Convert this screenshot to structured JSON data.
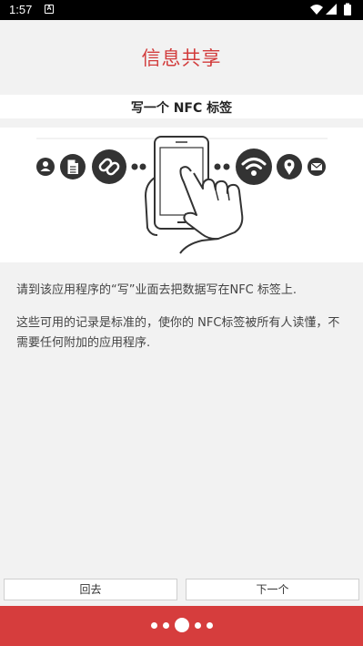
{
  "status_bar": {
    "time": "1:57",
    "notification_icon_letter": "A",
    "icons": [
      "wifi-icon",
      "signal-icon",
      "battery-icon"
    ]
  },
  "header": {
    "title": "信息共享"
  },
  "subtitle": "写一个 NFC 标签",
  "illustration": {
    "icons": [
      "person-icon",
      "document-icon",
      "link-icon",
      "phone-tap-icon",
      "wifi-icon",
      "location-icon",
      "mail-icon"
    ]
  },
  "content": {
    "paragraph1": "请到该应用程序的“写”业面去把数据写在NFC 标签上.",
    "paragraph2": "这些可用的记录是标准的，使你的 NFC标签被所有人读懂，不需要任何附加的应用程序."
  },
  "buttons": {
    "back": "回去",
    "next": "下一个"
  },
  "pager": {
    "pages": 5,
    "current": 3
  },
  "colors": {
    "accent": "#d63d3d",
    "title": "#d23c3c",
    "status_bar": "#000000"
  }
}
